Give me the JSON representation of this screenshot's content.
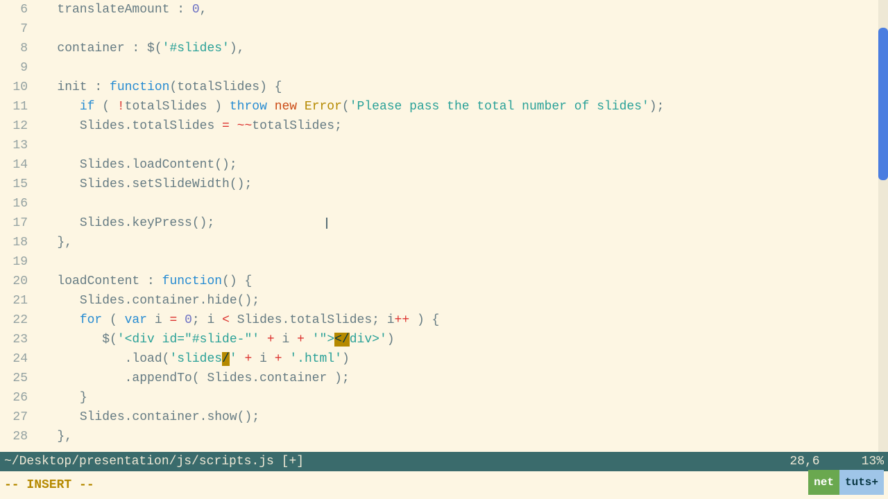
{
  "gutter": {
    "start": 6,
    "end": 28
  },
  "code": {
    "l6": {
      "pad": "   ",
      "a": "translateAmount : ",
      "num": "0",
      "b": ","
    },
    "l7": {
      "pad": "   "
    },
    "l8": {
      "pad": "   ",
      "a": "container : $(",
      "s": "'#slides'",
      "b": "),"
    },
    "l9": {
      "pad": "   "
    },
    "l10": {
      "pad": "   ",
      "a": "init : ",
      "kw": "function",
      "b": "(totalSlides) {"
    },
    "l11": {
      "pad": "      ",
      "kw": "if",
      "a": " ( ",
      "op": "!",
      "b": "totalSlides ) ",
      "kw2": "throw ",
      "kw3": "new ",
      "err": "Error",
      "c": "(",
      "s": "'Please pass the total number of slides'",
      "d": ");"
    },
    "l12": {
      "pad": "      ",
      "a": "Slides.totalSlides ",
      "op": "= ~~",
      "b": "totalSlides;"
    },
    "l13": {
      "pad": "      "
    },
    "l14": {
      "pad": "      ",
      "a": "Slides.loadContent();"
    },
    "l15": {
      "pad": "      ",
      "a": "Slides.setSlideWidth();"
    },
    "l16": {
      "pad": "      "
    },
    "l17": {
      "pad": "      ",
      "a": "Slides.keyPress();"
    },
    "l18": {
      "pad": "   ",
      "a": "},"
    },
    "l19": {
      "pad": "   "
    },
    "l20": {
      "pad": "   ",
      "a": "loadContent : ",
      "kw": "function",
      "b": "() {"
    },
    "l21": {
      "pad": "      ",
      "a": "Slides.container.hide();"
    },
    "l22": {
      "pad": "      ",
      "kw": "for",
      "a": " ( ",
      "kw2": "var",
      "b": " i ",
      "op": "=",
      "c": " ",
      "num": "0",
      "d": "; i ",
      "op2": "<",
      "e": " Slides.totalSlides; i",
      "op3": "++",
      "f": " ) {"
    },
    "l23": {
      "pad": "         ",
      "a": "$(",
      "s1": "'<div id=\"#slide-\"'",
      "b": " ",
      "op": "+",
      "c": " i ",
      "op2": "+",
      "d": " ",
      "s2": "'\">",
      "hl": "</",
      "s3": "div>'",
      "e": ")"
    },
    "l24": {
      "pad": "            ",
      "a": ".load(",
      "s1": "'slides",
      "hl": "/",
      "s2": "'",
      "b": " ",
      "op": "+",
      "c": " i ",
      "op2": "+",
      "d": " ",
      "s3": "'.html'",
      "e": ")"
    },
    "l25": {
      "pad": "            ",
      "a": ".appendTo( Slides.container );"
    },
    "l26": {
      "pad": "      ",
      "a": "}"
    },
    "l27": {
      "pad": "      ",
      "a": "Slides.container.show();"
    },
    "l28": {
      "pad": "   ",
      "a": "},"
    }
  },
  "status": {
    "path": "~/Desktop/presentation/js/scripts.js [+]",
    "pos": "28,6",
    "pct": "13%"
  },
  "mode": "-- INSERT --",
  "watermark": {
    "a": "net",
    "b": "tuts+"
  }
}
